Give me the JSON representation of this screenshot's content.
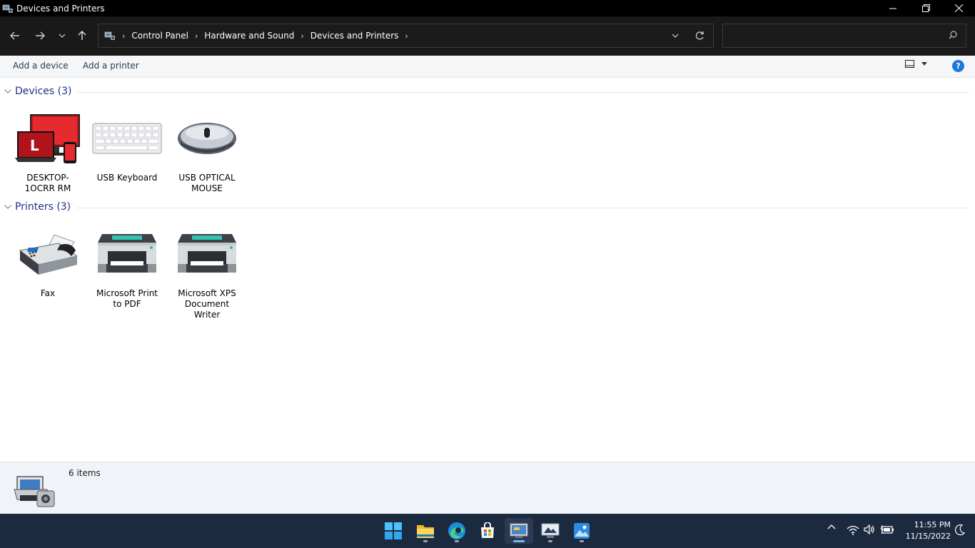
{
  "window": {
    "title": "Devices and Printers"
  },
  "address": {
    "breadcrumbs": [
      "Control Panel",
      "Hardware and Sound",
      "Devices and Printers"
    ]
  },
  "search": {
    "value": "",
    "placeholder": ""
  },
  "commands": {
    "add_device": "Add a device",
    "add_printer": "Add a printer",
    "help": "?"
  },
  "groups": {
    "devices": {
      "title": "Devices (3)",
      "items": [
        {
          "label": "DESKTOP-1OCRR RM",
          "icon": "computer-icon"
        },
        {
          "label": "USB Keyboard",
          "icon": "keyboard-icon"
        },
        {
          "label": "USB OPTICAL MOUSE",
          "icon": "mouse-icon"
        }
      ]
    },
    "printers": {
      "title": "Printers (3)",
      "items": [
        {
          "label": "Fax",
          "icon": "fax-icon"
        },
        {
          "label": "Microsoft Print to PDF",
          "icon": "printer-icon"
        },
        {
          "label": "Microsoft XPS Document Writer",
          "icon": "printer-icon"
        }
      ]
    }
  },
  "details": {
    "count": "6 items"
  },
  "taskbar": {
    "apps": [
      "start-icon",
      "file-explorer-icon",
      "edge-icon",
      "store-icon",
      "control-panel-icon",
      "remote-desktop-icon",
      "photos-icon"
    ],
    "active_app": "control-panel-icon"
  },
  "clock": {
    "time": "11:55 PM",
    "date": "11/15/2022"
  },
  "colors": {
    "accent": "#0078d4",
    "group_title": "#1e3287",
    "taskbar": "#1c2a40"
  }
}
